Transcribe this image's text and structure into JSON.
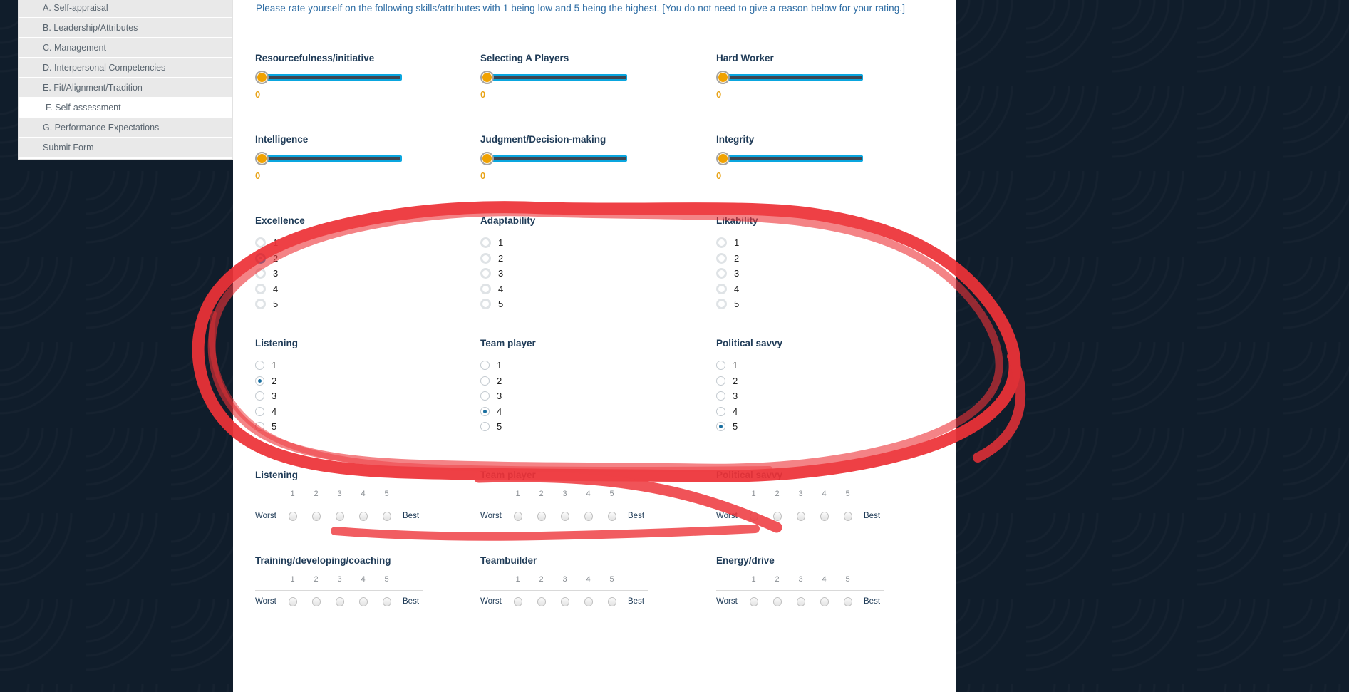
{
  "sidebar": {
    "items": [
      {
        "label": "A. Self-appraisal",
        "style": "shaded"
      },
      {
        "label": "B. Leadership/Attributes",
        "style": "shaded"
      },
      {
        "label": "C. Management",
        "style": "shaded"
      },
      {
        "label": "D. Interpersonal Competencies",
        "style": "shaded"
      },
      {
        "label": "E. Fit/Alignment/Tradition",
        "style": "shaded"
      },
      {
        "label": "F. Self-assessment",
        "style": "plain"
      },
      {
        "label": "G. Performance Expectations",
        "style": "shaded"
      },
      {
        "label": "Submit Form",
        "style": "shaded"
      }
    ]
  },
  "main": {
    "instructions": "Please rate yourself on the following skills/attributes with 1 being low and 5 being the highest. [You do not need to give a reason below for your rating.]",
    "slider_rows": [
      {
        "items": [
          {
            "label": "Resourcefulness/initiative",
            "value": "0"
          },
          {
            "label": "Selecting A Players",
            "value": "0"
          },
          {
            "label": "Hard Worker",
            "value": "0"
          }
        ]
      },
      {
        "items": [
          {
            "label": "Intelligence",
            "value": "0"
          },
          {
            "label": "Judgment/Decision-making",
            "value": "0"
          },
          {
            "label": "Integrity",
            "value": "0"
          }
        ]
      }
    ],
    "radio_rows": [
      {
        "style": "big",
        "items": [
          {
            "label": "Excellence",
            "options": [
              "1",
              "2",
              "3",
              "4",
              "5"
            ],
            "selected": "2"
          },
          {
            "label": "Adaptability",
            "options": [
              "1",
              "2",
              "3",
              "4",
              "5"
            ],
            "selected": null
          },
          {
            "label": "Likability",
            "options": [
              "1",
              "2",
              "3",
              "4",
              "5"
            ],
            "selected": null
          }
        ]
      },
      {
        "style": "small",
        "items": [
          {
            "label": "Listening",
            "options": [
              "1",
              "2",
              "3",
              "4",
              "5"
            ],
            "selected": "2"
          },
          {
            "label": "Team player",
            "options": [
              "1",
              "2",
              "3",
              "4",
              "5"
            ],
            "selected": "4"
          },
          {
            "label": "Political savvy",
            "options": [
              "1",
              "2",
              "3",
              "4",
              "5"
            ],
            "selected": "5"
          }
        ]
      }
    ],
    "scale_rows": [
      {
        "items": [
          {
            "label": "Listening",
            "numbers": [
              "1",
              "2",
              "3",
              "4",
              "5"
            ],
            "low": "Worst",
            "high": "Best",
            "selected": null
          },
          {
            "label": "Team player",
            "numbers": [
              "1",
              "2",
              "3",
              "4",
              "5"
            ],
            "low": "Worst",
            "high": "Best",
            "selected": null
          },
          {
            "label": "Political savvy",
            "numbers": [
              "1",
              "2",
              "3",
              "4",
              "5"
            ],
            "low": "Worst",
            "high": "Best",
            "selected": null
          }
        ]
      },
      {
        "items": [
          {
            "label": "Training/developing/coaching",
            "numbers": [
              "1",
              "2",
              "3",
              "4",
              "5"
            ],
            "low": "Worst",
            "high": "Best",
            "selected": null
          },
          {
            "label": "Teambuilder",
            "numbers": [
              "1",
              "2",
              "3",
              "4",
              "5"
            ],
            "low": "Worst",
            "high": "Best",
            "selected": null
          },
          {
            "label": "Energy/drive",
            "numbers": [
              "1",
              "2",
              "3",
              "4",
              "5"
            ],
            "low": "Worst",
            "high": "Best",
            "selected": null
          }
        ]
      }
    ]
  },
  "annotation": {
    "shape": "hand-drawn-red-ellipse",
    "color": "#ed3237"
  },
  "colors": {
    "instruction_text": "#2e6da4",
    "label_text": "#1f3b57",
    "slider_knob": "#f0a202",
    "slider_track": "#3f4651",
    "slider_border": "#0aa6df",
    "slider_value": "#e8a317",
    "radio_selected": "#1b87c9",
    "backdrop": "#101d2b",
    "sidebar_item_bg": "#e9e9e9"
  }
}
